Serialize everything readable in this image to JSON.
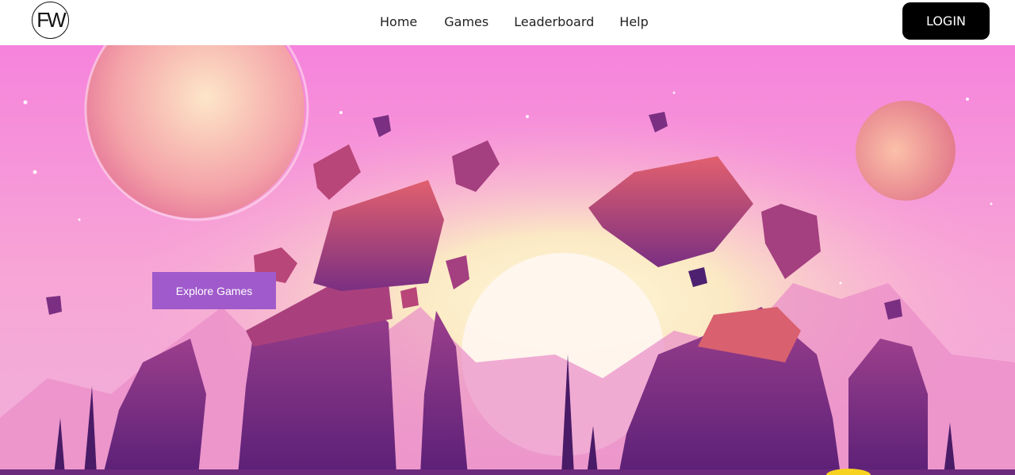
{
  "header": {
    "logo_text": "FW",
    "nav": [
      {
        "label": "Home"
      },
      {
        "label": "Games"
      },
      {
        "label": "Leaderboard"
      },
      {
        "label": "Help"
      }
    ],
    "login_label": "LOGIN"
  },
  "hero": {
    "cta_label": "Explore Games",
    "cta_color": "#a05acb",
    "background_color": "#f58fd8"
  },
  "colors": {
    "login_bg": "#000000",
    "sky_pink": "#f58fd8",
    "rock_purple": "#7b2f86"
  }
}
